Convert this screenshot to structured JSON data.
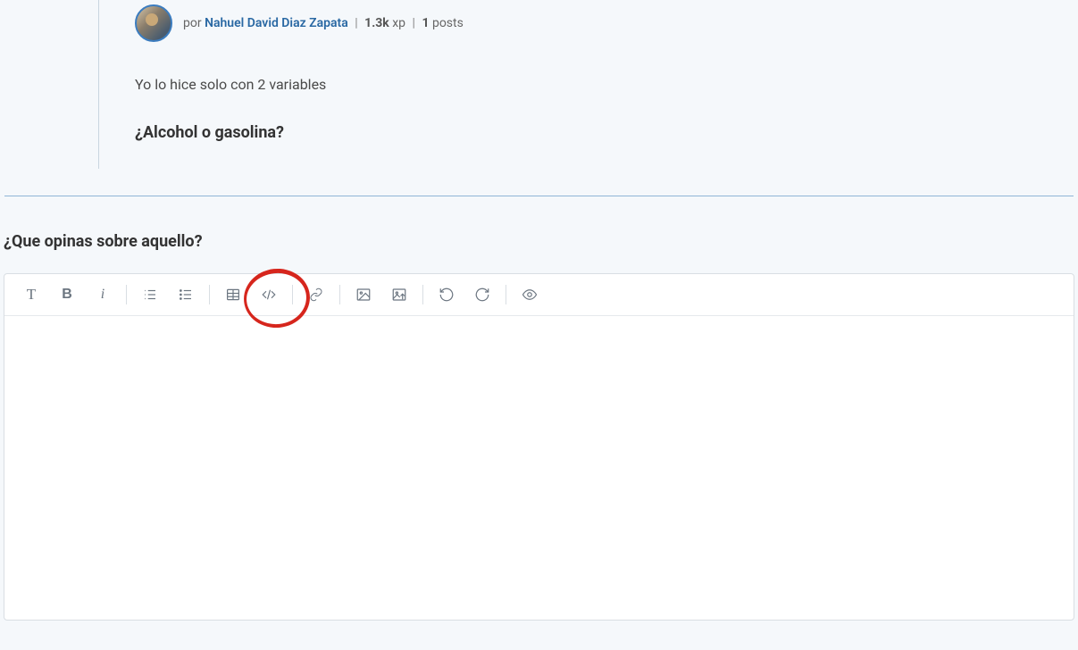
{
  "post": {
    "by_label": "por ",
    "author": "Nahuel David Diaz Zapata",
    "xp_value": "1.3k",
    "xp_label": " xp",
    "posts_value": "1",
    "posts_label": " posts",
    "body": "Yo lo hice solo con 2 variables",
    "subtitle": "¿Alcohol o gasolina?"
  },
  "reply": {
    "heading": "¿Que opinas sobre aquello?"
  },
  "toolbar": {
    "items": [
      {
        "name": "heading-icon"
      },
      {
        "name": "bold-icon"
      },
      {
        "name": "italic-icon"
      },
      {
        "sep": true
      },
      {
        "name": "ordered-list-icon"
      },
      {
        "name": "unordered-list-icon"
      },
      {
        "sep": true
      },
      {
        "name": "table-icon"
      },
      {
        "name": "code-icon"
      },
      {
        "sep": true
      },
      {
        "name": "link-icon"
      },
      {
        "sep": true
      },
      {
        "name": "image-icon"
      },
      {
        "name": "image-upload-icon"
      },
      {
        "sep": true
      },
      {
        "name": "undo-icon"
      },
      {
        "name": "redo-icon"
      },
      {
        "sep": true
      },
      {
        "name": "preview-icon"
      }
    ]
  }
}
